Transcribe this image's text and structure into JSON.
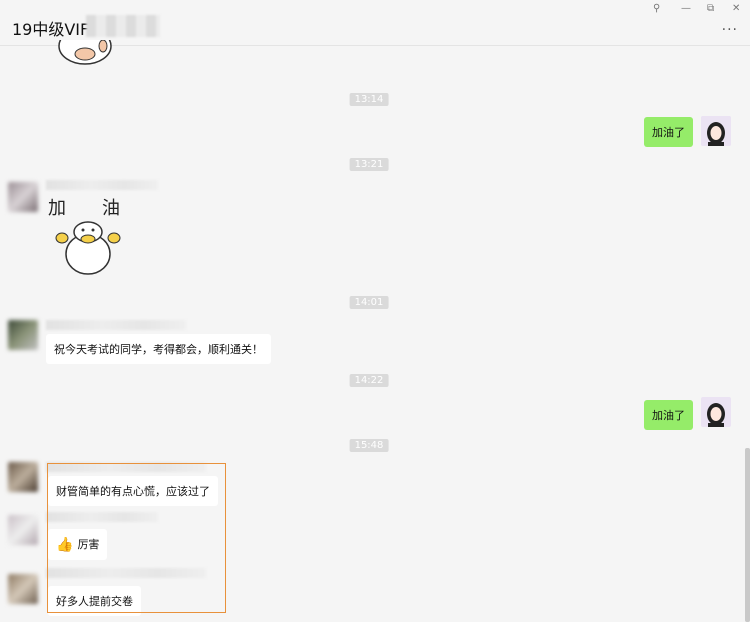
{
  "window": {
    "title": "19中级VIF",
    "pin_icon": "pin-icon",
    "minimize": "—",
    "restore": "⧉",
    "close": "✕",
    "more": "···"
  },
  "colors": {
    "self_bubble": "#95ec69",
    "other_bubble": "#ffffff",
    "highlight_border": "#e8913b"
  },
  "messages": {
    "t1": "13:14",
    "m1": "加油了",
    "t2": "13:21",
    "sticker_text_1": "加",
    "sticker_text_2": "油",
    "t3": "14:01",
    "m3": "祝今天考试的同学，考得都会，顺利通关！",
    "t4": "14:22",
    "m4": "加油了",
    "t5": "15:48",
    "m5": "财管简单的有点心慌，应该过了",
    "m6": "厉害",
    "m7": "好多人提前交卷"
  }
}
